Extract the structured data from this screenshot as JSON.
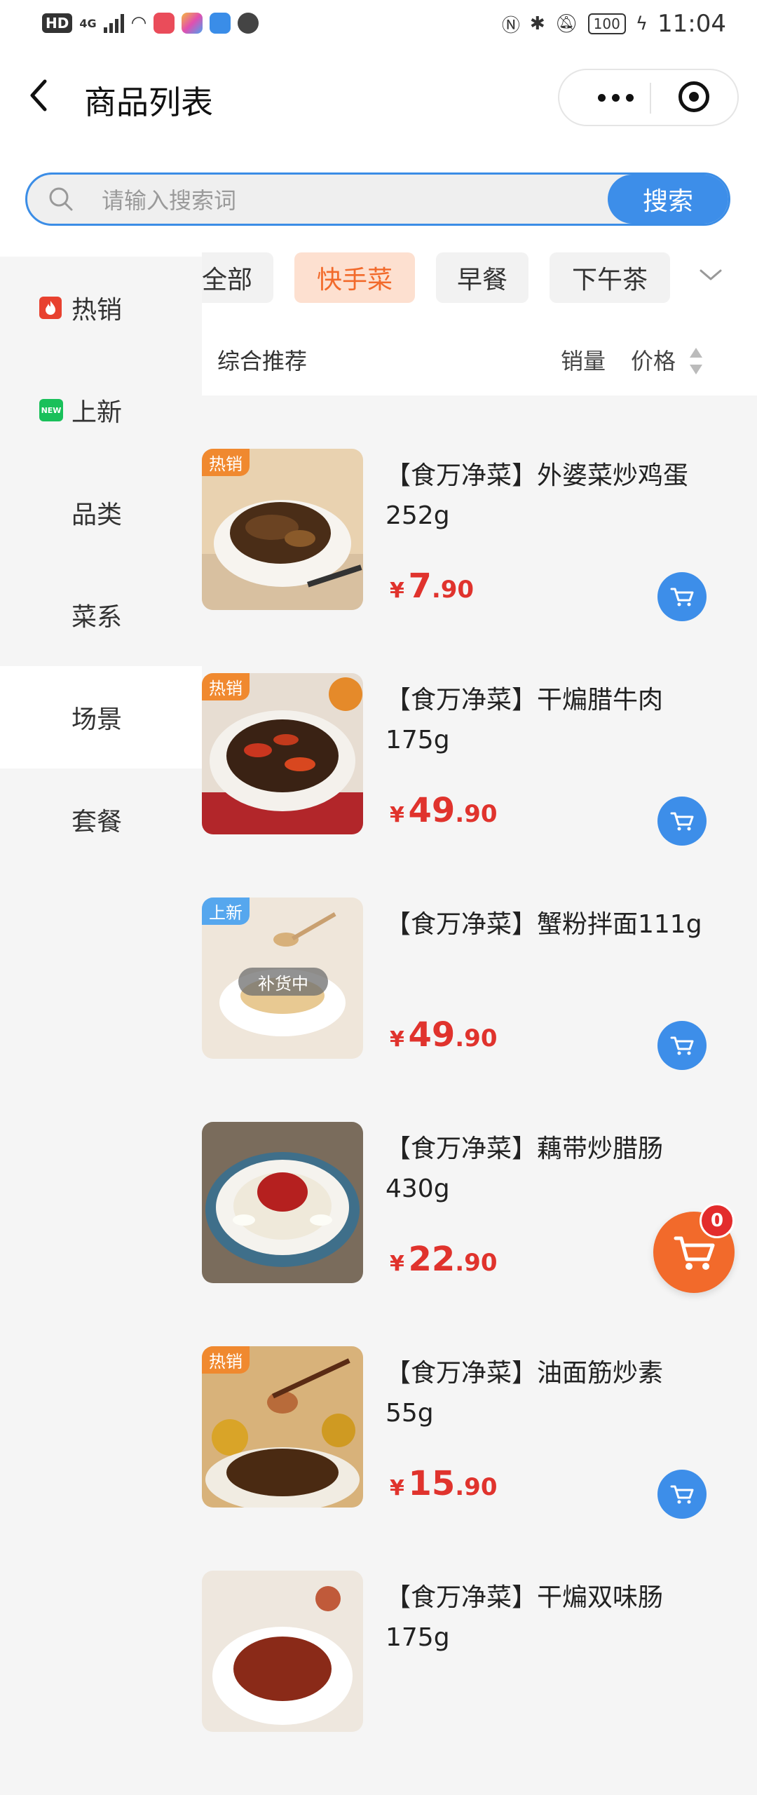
{
  "status_bar": {
    "hd": "HD",
    "signal": "4G",
    "battery": "100",
    "time": "11:04"
  },
  "navbar": {
    "title": "商品列表"
  },
  "search": {
    "placeholder": "请输入搜索词",
    "button_label": "搜索"
  },
  "sidebar": {
    "items": [
      {
        "label": "热销",
        "icon": "fire-icon"
      },
      {
        "label": "上新",
        "icon": "new-icon"
      },
      {
        "label": "品类"
      },
      {
        "label": "菜系"
      },
      {
        "label": "场景",
        "active": true
      },
      {
        "label": "套餐"
      }
    ]
  },
  "tabs": {
    "items": [
      "全部",
      "快手菜",
      "早餐",
      "下午茶"
    ],
    "active_index": 1
  },
  "sort": {
    "main": "综合推荐",
    "sales": "销量",
    "price": "价格"
  },
  "products": [
    {
      "name": "【食万净菜】外婆菜炒鸡蛋252g",
      "badge": "热销",
      "price_currency": "¥",
      "price_int": "7",
      "price_dec": ".90"
    },
    {
      "name": "【食万净菜】干煸腊牛肉175g",
      "badge": "热销",
      "price_currency": "¥",
      "price_int": "49",
      "price_dec": ".90"
    },
    {
      "name": "【食万净菜】蟹粉拌面111g",
      "badge": "上新",
      "overlay": "补货中",
      "price_currency": "¥",
      "price_int": "49",
      "price_dec": ".90"
    },
    {
      "name": "【食万净菜】藕带炒腊肠430g",
      "price_currency": "¥",
      "price_int": "22",
      "price_dec": ".90"
    },
    {
      "name": "【食万净菜】油面筋炒素55g",
      "badge": "热销",
      "price_currency": "¥",
      "price_int": "15",
      "price_dec": ".90"
    },
    {
      "name": "【食万净菜】干煸双味肠175g"
    }
  ],
  "cart": {
    "count": "0"
  },
  "colors": {
    "accent": "#3d8ee9",
    "price": "#e0332d",
    "tab_active": "#f26a2b",
    "hot_tag": "#f0892f",
    "new_tag": "#56a7ee"
  }
}
